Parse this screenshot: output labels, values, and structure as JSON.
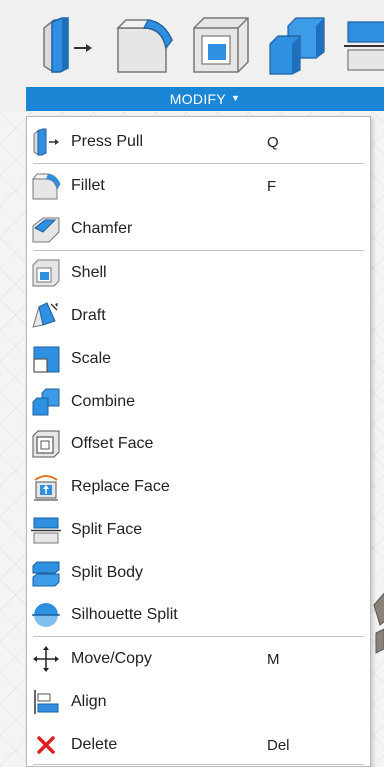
{
  "toolbar": {
    "group_label": "MODIFY",
    "tools": [
      {
        "icon": "press-pull-icon"
      },
      {
        "icon": "fillet-icon"
      },
      {
        "icon": "shell-icon"
      },
      {
        "icon": "combine-icon"
      },
      {
        "icon": "split-face-icon"
      }
    ]
  },
  "menu": {
    "items": [
      {
        "label": "Press Pull",
        "shortcut": "Q",
        "icon": "press-pull-icon"
      },
      {
        "label": "Fillet",
        "shortcut": "F",
        "icon": "fillet-icon"
      },
      {
        "label": "Chamfer",
        "shortcut": "",
        "icon": "chamfer-icon"
      },
      {
        "label": "Shell",
        "shortcut": "",
        "icon": "shell-icon"
      },
      {
        "label": "Draft",
        "shortcut": "",
        "icon": "draft-icon"
      },
      {
        "label": "Scale",
        "shortcut": "",
        "icon": "scale-icon"
      },
      {
        "label": "Combine",
        "shortcut": "",
        "icon": "combine-icon"
      },
      {
        "label": "Offset Face",
        "shortcut": "",
        "icon": "offset-face-icon"
      },
      {
        "label": "Replace Face",
        "shortcut": "",
        "icon": "replace-face-icon"
      },
      {
        "label": "Split Face",
        "shortcut": "",
        "icon": "split-face-icon"
      },
      {
        "label": "Split Body",
        "shortcut": "",
        "icon": "split-body-icon"
      },
      {
        "label": "Silhouette Split",
        "shortcut": "",
        "icon": "silhouette-split-icon"
      },
      {
        "label": "Move/Copy",
        "shortcut": "M",
        "icon": "move-copy-icon"
      },
      {
        "label": "Align",
        "shortcut": "",
        "icon": "align-icon"
      },
      {
        "label": "Delete",
        "shortcut": "Del",
        "icon": "delete-icon"
      }
    ]
  },
  "colors": {
    "accent": "#1b86d6",
    "icon_blue": "#2f8fe0",
    "icon_gray": "#e4e4e4",
    "delete_red": "#e02020"
  }
}
